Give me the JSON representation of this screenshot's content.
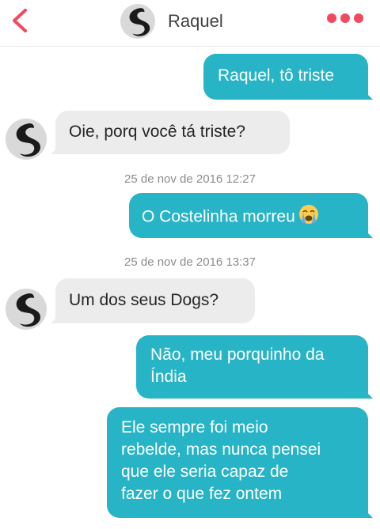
{
  "header": {
    "contact_name": "Raquel",
    "back_icon": "chevron-left-icon",
    "more_icon": "more-dots-icon",
    "accent_color": "#f04a5f"
  },
  "messages": [
    {
      "direction": "sent",
      "text": "Raquel, tô triste"
    },
    {
      "direction": "received",
      "text": "Oie, porq você tá triste?"
    },
    {
      "type": "timestamp",
      "text": "25 de nov de 2016 12:27"
    },
    {
      "direction": "sent",
      "text": "O Costelinha morreu",
      "emoji": "crying-face"
    },
    {
      "type": "timestamp",
      "text": "25 de nov de 2016 13:37"
    },
    {
      "direction": "received",
      "text": "Um dos seus Dogs?"
    },
    {
      "direction": "sent",
      "lines": [
        "Não, meu porquinho da",
        "Índia"
      ]
    },
    {
      "direction": "sent",
      "lines": [
        "Ele sempre foi meio",
        "rebelde, mas nunca pensei",
        "que ele seria capaz de",
        "fazer o que fez ontem"
      ]
    }
  ],
  "colors": {
    "sent_bubble": "#27b4c6",
    "received_bubble": "#ececec",
    "timestamp_text": "#8c8c8c"
  }
}
